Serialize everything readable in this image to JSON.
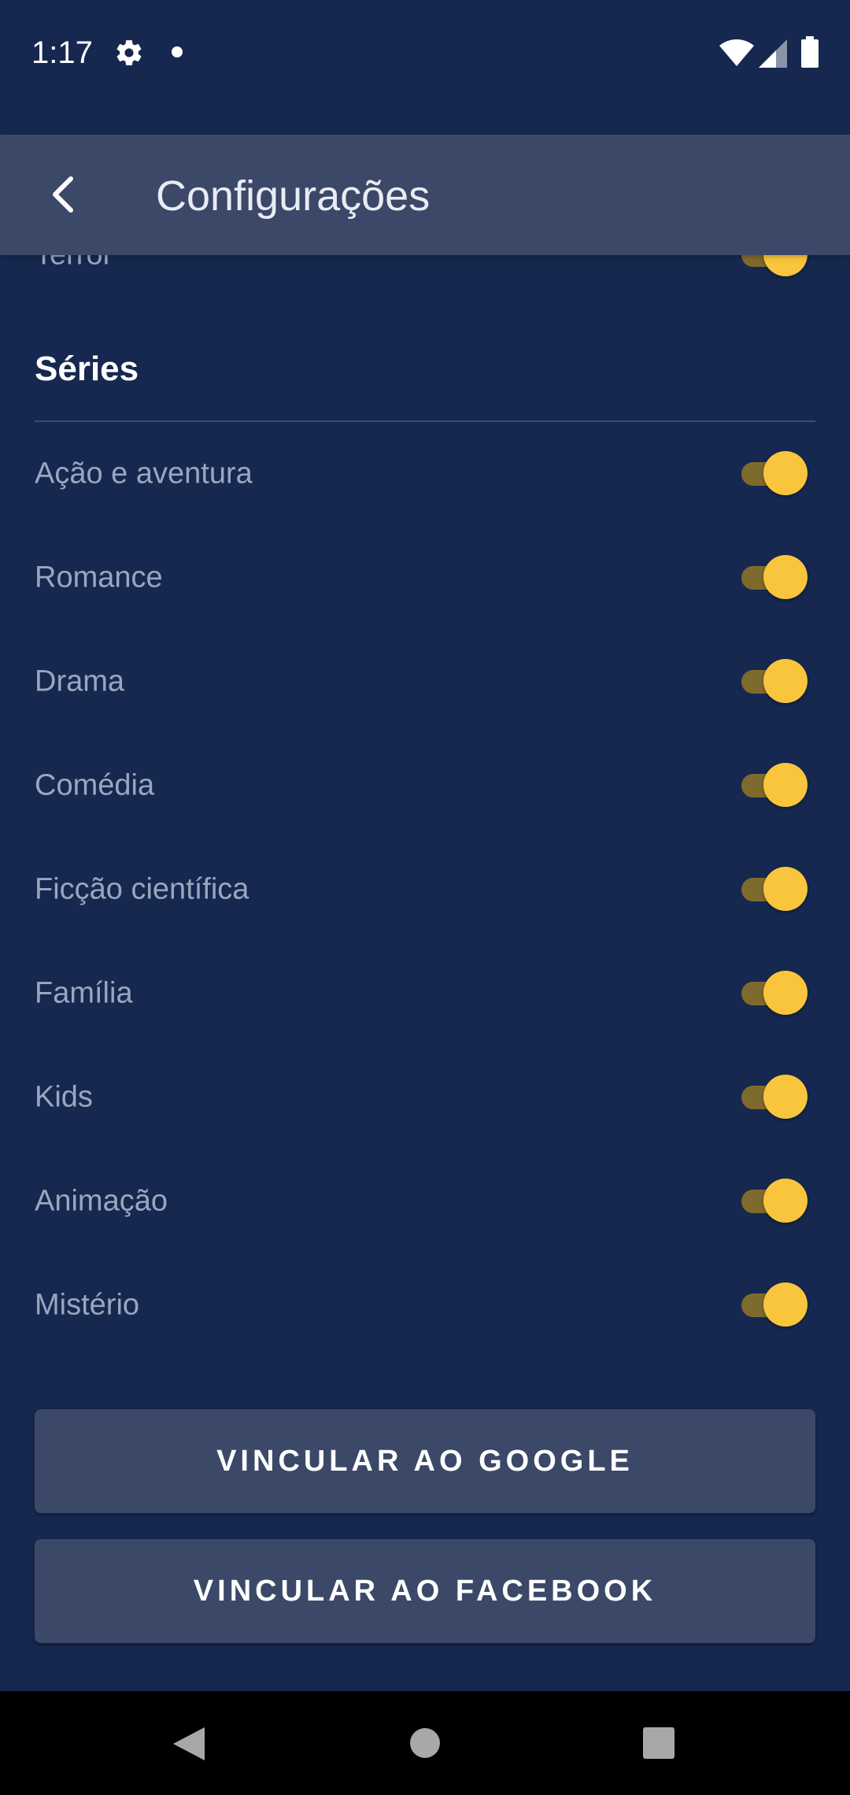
{
  "status_bar": {
    "time": "1:17",
    "icons": [
      "gear-icon",
      "notification-dot-icon",
      "wifi-icon",
      "signal-icon",
      "battery-icon"
    ]
  },
  "app_bar": {
    "title": "Configurações",
    "back_icon": "chevron-left-icon"
  },
  "previous_section": {
    "partial_item": {
      "label": "Terror",
      "enabled": true
    }
  },
  "series_section": {
    "title": "Séries",
    "items": [
      {
        "label": "Ação e aventura",
        "enabled": true
      },
      {
        "label": "Romance",
        "enabled": true
      },
      {
        "label": "Drama",
        "enabled": true
      },
      {
        "label": "Comédia",
        "enabled": true
      },
      {
        "label": "Ficção científica",
        "enabled": true
      },
      {
        "label": "Família",
        "enabled": true
      },
      {
        "label": "Kids",
        "enabled": true
      },
      {
        "label": "Animação",
        "enabled": true
      },
      {
        "label": "Mistério",
        "enabled": true
      }
    ]
  },
  "buttons": {
    "google": "VINCULAR AO GOOGLE",
    "facebook": "VINCULAR AO FACEBOOK"
  },
  "colors": {
    "background": "#16284f",
    "app_bar": "#3b4868",
    "switch_thumb": "#f9c53c",
    "switch_track": "#7f6a2e",
    "label_text": "#9aa6bf"
  },
  "nav_bar": {
    "icons": [
      "back-triangle-icon",
      "home-circle-icon",
      "recents-square-icon"
    ]
  }
}
